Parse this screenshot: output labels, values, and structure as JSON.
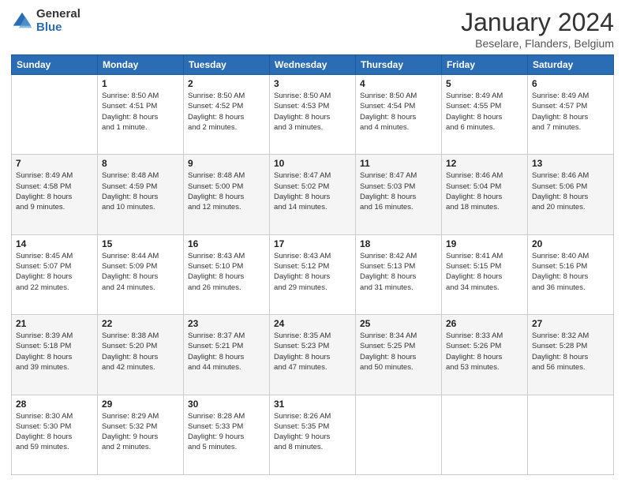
{
  "header": {
    "logo_general": "General",
    "logo_blue": "Blue",
    "month_title": "January 2024",
    "location": "Beselare, Flanders, Belgium"
  },
  "weekdays": [
    "Sunday",
    "Monday",
    "Tuesday",
    "Wednesday",
    "Thursday",
    "Friday",
    "Saturday"
  ],
  "weeks": [
    [
      {
        "day": "",
        "info": ""
      },
      {
        "day": "1",
        "info": "Sunrise: 8:50 AM\nSunset: 4:51 PM\nDaylight: 8 hours\nand 1 minute."
      },
      {
        "day": "2",
        "info": "Sunrise: 8:50 AM\nSunset: 4:52 PM\nDaylight: 8 hours\nand 2 minutes."
      },
      {
        "day": "3",
        "info": "Sunrise: 8:50 AM\nSunset: 4:53 PM\nDaylight: 8 hours\nand 3 minutes."
      },
      {
        "day": "4",
        "info": "Sunrise: 8:50 AM\nSunset: 4:54 PM\nDaylight: 8 hours\nand 4 minutes."
      },
      {
        "day": "5",
        "info": "Sunrise: 8:49 AM\nSunset: 4:55 PM\nDaylight: 8 hours\nand 6 minutes."
      },
      {
        "day": "6",
        "info": "Sunrise: 8:49 AM\nSunset: 4:57 PM\nDaylight: 8 hours\nand 7 minutes."
      }
    ],
    [
      {
        "day": "7",
        "info": "Sunrise: 8:49 AM\nSunset: 4:58 PM\nDaylight: 8 hours\nand 9 minutes."
      },
      {
        "day": "8",
        "info": "Sunrise: 8:48 AM\nSunset: 4:59 PM\nDaylight: 8 hours\nand 10 minutes."
      },
      {
        "day": "9",
        "info": "Sunrise: 8:48 AM\nSunset: 5:00 PM\nDaylight: 8 hours\nand 12 minutes."
      },
      {
        "day": "10",
        "info": "Sunrise: 8:47 AM\nSunset: 5:02 PM\nDaylight: 8 hours\nand 14 minutes."
      },
      {
        "day": "11",
        "info": "Sunrise: 8:47 AM\nSunset: 5:03 PM\nDaylight: 8 hours\nand 16 minutes."
      },
      {
        "day": "12",
        "info": "Sunrise: 8:46 AM\nSunset: 5:04 PM\nDaylight: 8 hours\nand 18 minutes."
      },
      {
        "day": "13",
        "info": "Sunrise: 8:46 AM\nSunset: 5:06 PM\nDaylight: 8 hours\nand 20 minutes."
      }
    ],
    [
      {
        "day": "14",
        "info": "Sunrise: 8:45 AM\nSunset: 5:07 PM\nDaylight: 8 hours\nand 22 minutes."
      },
      {
        "day": "15",
        "info": "Sunrise: 8:44 AM\nSunset: 5:09 PM\nDaylight: 8 hours\nand 24 minutes."
      },
      {
        "day": "16",
        "info": "Sunrise: 8:43 AM\nSunset: 5:10 PM\nDaylight: 8 hours\nand 26 minutes."
      },
      {
        "day": "17",
        "info": "Sunrise: 8:43 AM\nSunset: 5:12 PM\nDaylight: 8 hours\nand 29 minutes."
      },
      {
        "day": "18",
        "info": "Sunrise: 8:42 AM\nSunset: 5:13 PM\nDaylight: 8 hours\nand 31 minutes."
      },
      {
        "day": "19",
        "info": "Sunrise: 8:41 AM\nSunset: 5:15 PM\nDaylight: 8 hours\nand 34 minutes."
      },
      {
        "day": "20",
        "info": "Sunrise: 8:40 AM\nSunset: 5:16 PM\nDaylight: 8 hours\nand 36 minutes."
      }
    ],
    [
      {
        "day": "21",
        "info": "Sunrise: 8:39 AM\nSunset: 5:18 PM\nDaylight: 8 hours\nand 39 minutes."
      },
      {
        "day": "22",
        "info": "Sunrise: 8:38 AM\nSunset: 5:20 PM\nDaylight: 8 hours\nand 42 minutes."
      },
      {
        "day": "23",
        "info": "Sunrise: 8:37 AM\nSunset: 5:21 PM\nDaylight: 8 hours\nand 44 minutes."
      },
      {
        "day": "24",
        "info": "Sunrise: 8:35 AM\nSunset: 5:23 PM\nDaylight: 8 hours\nand 47 minutes."
      },
      {
        "day": "25",
        "info": "Sunrise: 8:34 AM\nSunset: 5:25 PM\nDaylight: 8 hours\nand 50 minutes."
      },
      {
        "day": "26",
        "info": "Sunrise: 8:33 AM\nSunset: 5:26 PM\nDaylight: 8 hours\nand 53 minutes."
      },
      {
        "day": "27",
        "info": "Sunrise: 8:32 AM\nSunset: 5:28 PM\nDaylight: 8 hours\nand 56 minutes."
      }
    ],
    [
      {
        "day": "28",
        "info": "Sunrise: 8:30 AM\nSunset: 5:30 PM\nDaylight: 8 hours\nand 59 minutes."
      },
      {
        "day": "29",
        "info": "Sunrise: 8:29 AM\nSunset: 5:32 PM\nDaylight: 9 hours\nand 2 minutes."
      },
      {
        "day": "30",
        "info": "Sunrise: 8:28 AM\nSunset: 5:33 PM\nDaylight: 9 hours\nand 5 minutes."
      },
      {
        "day": "31",
        "info": "Sunrise: 8:26 AM\nSunset: 5:35 PM\nDaylight: 9 hours\nand 8 minutes."
      },
      {
        "day": "",
        "info": ""
      },
      {
        "day": "",
        "info": ""
      },
      {
        "day": "",
        "info": ""
      }
    ]
  ]
}
